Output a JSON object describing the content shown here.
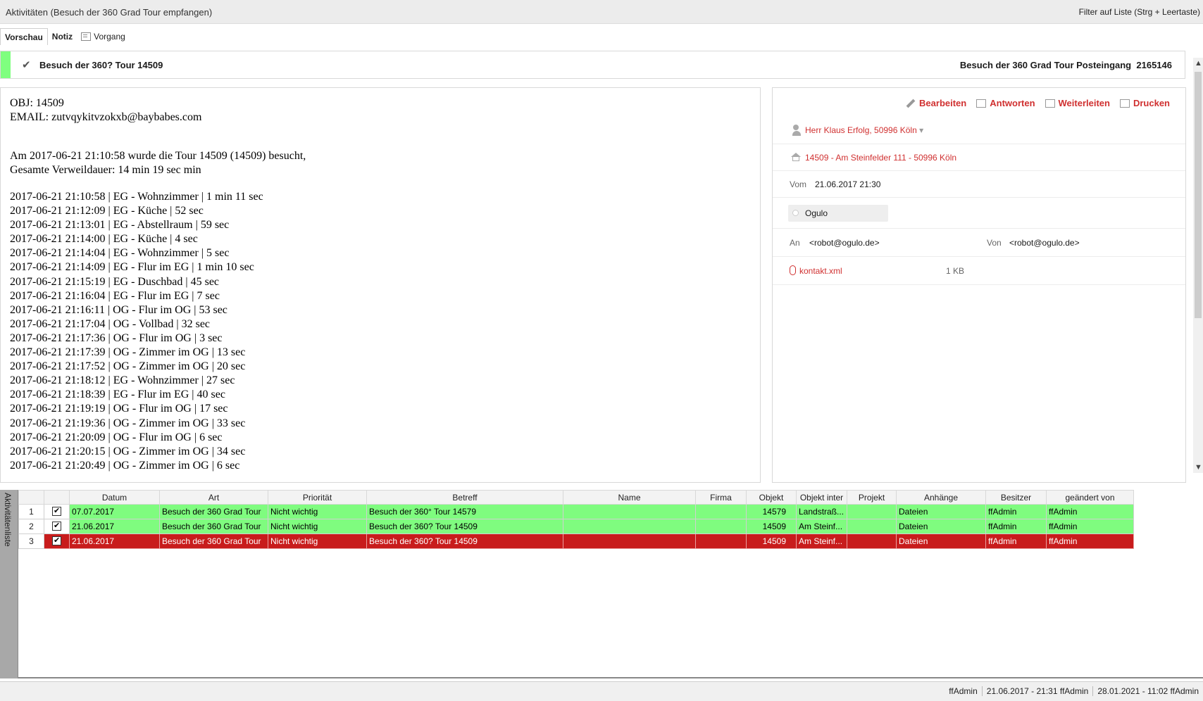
{
  "window": {
    "title": "Aktivitäten (Besuch der 360 Grad Tour empfangen)",
    "filter_hint": "Filter auf Liste (Strg + Leertaste)"
  },
  "tabs": [
    {
      "label": "Vorschau"
    },
    {
      "label": "Notiz"
    },
    {
      "label": "Vorgang"
    }
  ],
  "header": {
    "subject": "Besuch der 360? Tour 14509",
    "right_label": "Besuch der 360 Grad Tour Posteingang",
    "id": "2165146",
    "status_color": "#7fff7f"
  },
  "email_body": {
    "obj_line": "OBJ: 14509",
    "email_line": "EMAIL: zutvqykitvzokxb@baybabes.com",
    "visit_line": "Am 2017-06-21 21:10:58 wurde die Tour 14509 (14509) besucht,",
    "duration_line": "Gesamte Verweildauer: 14 min 19 sec min",
    "timeline": [
      "2017-06-21 21:10:58 | EG - Wohnzimmer | 1 min 11 sec",
      "2017-06-21 21:12:09 | EG - Küche | 52 sec",
      "2017-06-21 21:13:01 | EG - Abstellraum | 59 sec",
      "2017-06-21 21:14:00 | EG - Küche | 4 sec",
      "2017-06-21 21:14:04 | EG - Wohnzimmer | 5 sec",
      "2017-06-21 21:14:09 | EG - Flur im EG | 1 min 10 sec",
      "2017-06-21 21:15:19 | EG - Duschbad | 45 sec",
      "2017-06-21 21:16:04 | EG - Flur im EG | 7 sec",
      "2017-06-21 21:16:11 | OG - Flur im OG | 53 sec",
      "2017-06-21 21:17:04 | OG - Vollbad | 32 sec",
      "2017-06-21 21:17:36 | OG - Flur im OG | 3 sec",
      "2017-06-21 21:17:39 | OG - Zimmer im OG | 13 sec",
      "2017-06-21 21:17:52 | OG - Zimmer im OG | 20 sec",
      "2017-06-21 21:18:12 | EG - Wohnzimmer | 27 sec",
      "2017-06-21 21:18:39 | EG - Flur im EG | 40 sec",
      "2017-06-21 21:19:19 | OG - Flur im OG | 17 sec",
      "2017-06-21 21:19:36 | OG - Zimmer im OG | 33 sec",
      "2017-06-21 21:20:09 | OG - Flur im OG | 6 sec",
      "2017-06-21 21:20:15 | OG - Zimmer im OG | 34 sec",
      "2017-06-21 21:20:49 | OG - Zimmer im OG | 6 sec"
    ]
  },
  "detail": {
    "actions": {
      "edit": "Bearbeiten",
      "reply": "Antworten",
      "forward": "Weiterleiten",
      "print": "Drucken"
    },
    "contact": "Herr Klaus Erfolg, 50996 Köln",
    "object": "14509 - Am Steinfelder 111 - 50996 Köln",
    "date_label": "Vom",
    "date_value": "21.06.2017 21:30",
    "tag": "Ogulo",
    "to_label": "An",
    "to_value": "<robot@ogulo.de>",
    "from_label": "Von",
    "from_value": "<robot@ogulo.de>",
    "attachment_name": "kontakt.xml",
    "attachment_size": "1 KB",
    "accent_color": "#d03030"
  },
  "grid": {
    "side_label": "Aktivitätenliste",
    "columns": [
      "Datum",
      "Art",
      "Priorität",
      "Betreff",
      "Name",
      "Firma",
      "Objekt",
      "Objekt inter",
      "Projekt",
      "Anhänge",
      "Besitzer",
      "geändert von"
    ],
    "rows": [
      {
        "num": "1",
        "checked": true,
        "state": "green",
        "datum": "07.07.2017",
        "art": "Besuch der 360 Grad Tour",
        "prio": "Nicht wichtig",
        "betreff": "Besuch der 360° Tour 14579",
        "name": "",
        "firma": "",
        "objekt": "14579",
        "objekt_inter": "Landstraß...",
        "projekt": "",
        "anhaenge": "Dateien",
        "besitzer": "ffAdmin",
        "geaendert": "ffAdmin"
      },
      {
        "num": "2",
        "checked": true,
        "state": "green",
        "datum": "21.06.2017",
        "art": "Besuch der 360 Grad Tour",
        "prio": "Nicht wichtig",
        "betreff": "Besuch der 360? Tour 14509",
        "name": "",
        "firma": "",
        "objekt": "14509",
        "objekt_inter": "Am Steinf...",
        "projekt": "",
        "anhaenge": "Dateien",
        "besitzer": "ffAdmin",
        "geaendert": "ffAdmin"
      },
      {
        "num": "3",
        "checked": true,
        "state": "red",
        "datum": "21.06.2017",
        "art": "Besuch der 360 Grad Tour",
        "prio": "Nicht wichtig",
        "betreff": "Besuch der 360? Tour 14509",
        "name": "",
        "firma": "",
        "objekt": "14509",
        "objekt_inter": "Am Steinf...",
        "projekt": "",
        "anhaenge": "Dateien",
        "besitzer": "ffAdmin",
        "geaendert": "ffAdmin"
      }
    ]
  },
  "status": {
    "user": "ffAdmin",
    "created": "21.06.2017 - 21:31 ffAdmin",
    "modified": "28.01.2021 - 11:02 ffAdmin"
  }
}
